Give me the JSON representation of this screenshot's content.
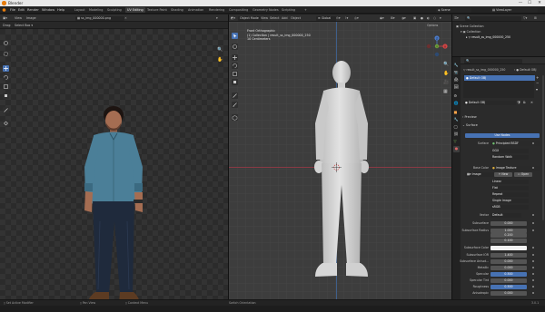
{
  "window": {
    "title": "Blender",
    "min": "—",
    "max": "☐",
    "close": "✕"
  },
  "menu": {
    "items": [
      "File",
      "Edit",
      "Render",
      "Window",
      "Help"
    ]
  },
  "workspaces": [
    "Layout",
    "Modeling",
    "Sculpting",
    "UV Editing",
    "Texture Paint",
    "Shading",
    "Animation",
    "Rendering",
    "Compositing",
    "Geometry Nodes",
    "Scripting"
  ],
  "active_workspace_index": 3,
  "scene": {
    "name": "Scene",
    "layer": "ViewLayer"
  },
  "image_editor": {
    "menus": [
      "View",
      "Image"
    ],
    "image_name": "ss_img_000000.png",
    "drag_label": "Drag:",
    "select_box": "Select Box"
  },
  "viewport": {
    "mode": "Object Mode",
    "menus": [
      "View",
      "Select",
      "Add",
      "Object"
    ],
    "transform": "Global",
    "options": "Options",
    "overlay": {
      "view": "Front Orthographic",
      "collection": "(1) Collection | result_ss_img_000000_250",
      "units": "10 Centimeters"
    },
    "axes": {
      "x": "X",
      "y": "Y",
      "z": "Z"
    }
  },
  "outliner": {
    "root": "Scene Collection",
    "collection": "Collection",
    "object": "result_ss_img_000000_250"
  },
  "properties": {
    "object_name": "result_ss_img_000000_250",
    "material_slot": "Default OBJ",
    "material_name": "Default OBJ",
    "sections": {
      "preview": "Preview",
      "surface": "Surface"
    },
    "use_nodes": "Use Nodes",
    "surface_label": "Surface",
    "surface_value": "Principled BSDF",
    "distribution": "GGX",
    "subsurface_method": "Random Walk",
    "base_color_label": "Base Color",
    "base_color_value": "Image Texture",
    "image_name": "Image",
    "new_label": "New",
    "open_label": "Open",
    "rows": [
      {
        "label": "",
        "value": "Linear"
      },
      {
        "label": "",
        "value": "Flat"
      },
      {
        "label": "",
        "value": "Repeat"
      },
      {
        "label": "",
        "value": "Single Image"
      },
      {
        "label": "",
        "value": "sRGB"
      },
      {
        "label": "Vector",
        "value": "Default"
      },
      {
        "label": "Subsurface",
        "value": "0.000"
      },
      {
        "label": "Subsurface Radius",
        "value": "1.000"
      },
      {
        "label": "",
        "value": "0.200"
      },
      {
        "label": "",
        "value": "0.100"
      },
      {
        "label": "Subsurface Color",
        "value": ""
      },
      {
        "label": "Subsurface IOR",
        "value": "1.400"
      },
      {
        "label": "Subsurface Anisot...",
        "value": "0.000"
      },
      {
        "label": "Metallic",
        "value": "0.000"
      },
      {
        "label": "Specular",
        "value": "0.500"
      },
      {
        "label": "Specular Tint",
        "value": "0.000"
      },
      {
        "label": "Roughness",
        "value": "0.500"
      },
      {
        "label": "Anisotropic",
        "value": "0.000"
      }
    ]
  },
  "status": {
    "left": "Set Active Modifier",
    "mid1": "Pan View",
    "mid2": "Context Menu",
    "mid3": "Switch Orientation",
    "version": "3.0.1"
  },
  "colors": {
    "accent": "#4772b3",
    "blender_orange": "#e87d0d"
  }
}
